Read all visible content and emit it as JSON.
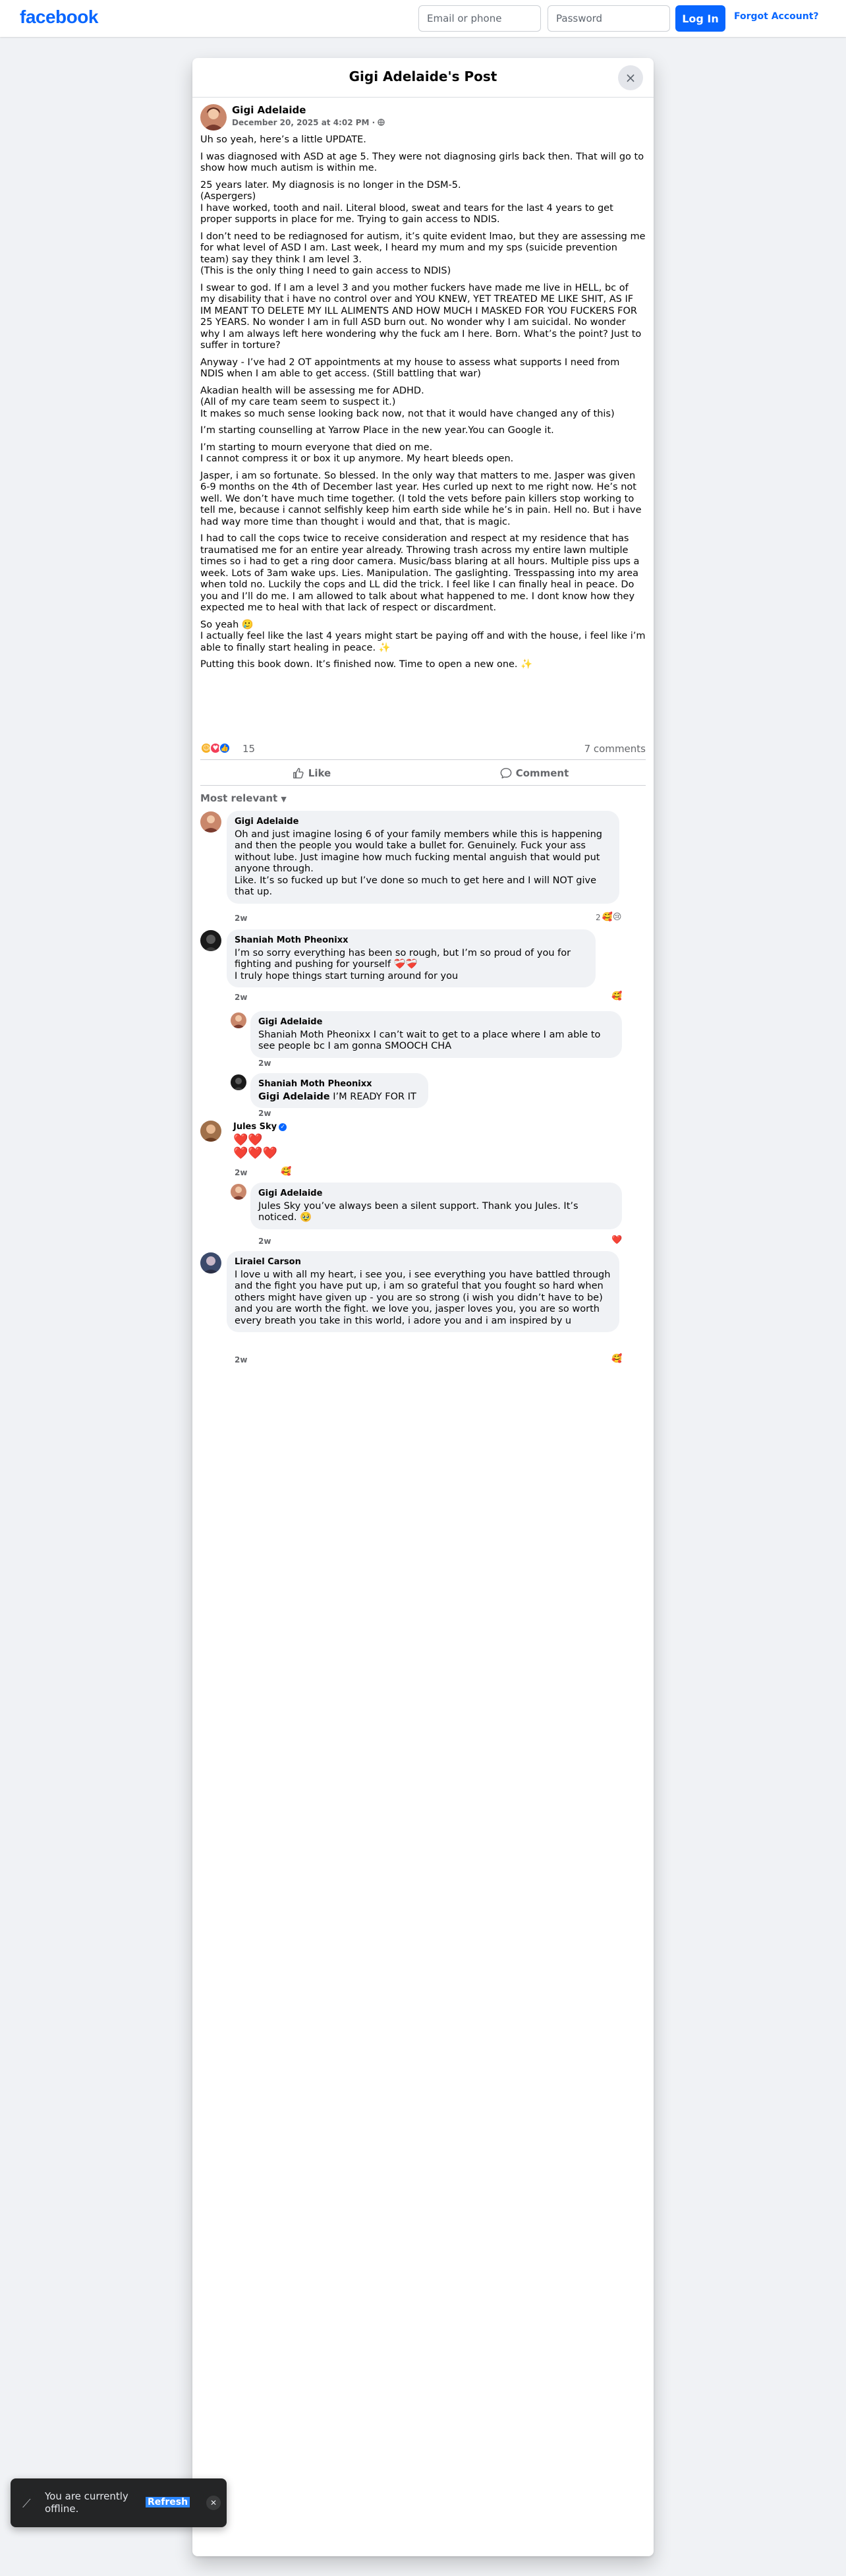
{
  "header": {
    "logo": "facebook",
    "email_placeholder": "Email or phone",
    "password_placeholder": "Password",
    "login_label": "Log In",
    "forgot_label": "Forgot Account?"
  },
  "modal": {
    "title": "Gigi Adelaide's Post",
    "close_icon": "×"
  },
  "post": {
    "author": "Gigi Adelaide",
    "date": "December 20, 2025 at 4:02 PM",
    "privacy_icon": "globe-icon",
    "paragraphs": [
      "Uh so yeah, here’s a little UPDATE.",
      "I was diagnosed with ASD at age 5. They were not diagnosing girls back then. That will go to show how much autism is within me.",
      "25 years later. My diagnosis is no longer in the DSM-5.\n(Aspergers)\nI have worked, tooth and nail. Literal blood, sweat and tears for the last 4 years to get proper supports in place for me. Trying to gain access to NDIS.",
      "I don’t need to be rediagnosed for autism, it’s quite evident lmao, but they are assessing me for what level of ASD I am. Last week, I heard my mum and my sps (suicide prevention team) say they think I am level 3.\n(This is the only thing I need to gain access to NDIS)",
      "I swear to god. If I am a level 3 and you mother fuckers have made me live in HELL, bc of my disability that i have no control over and YOU KNEW, YET TREATED ME LIKE SHIT, AS IF IM MEANT TO DELETE MY ILL ALIMENTS AND HOW MUCH I MASKED FOR YOU FUCKERS FOR 25 YEARS. No wonder I am in full ASD burn out. No wonder why I am suicidal. No wonder why I am always left here wondering why the fuck am I here. Born. What’s the point? Just to suffer in torture?",
      "Anyway - I’ve had 2 OT appointments at my house to assess what supports I need from NDIS when I am able to get access. (Still battling that war)",
      "Akadian health will be assessing me for ADHD.\n(All of my care team seem to suspect it.)\nIt makes so much sense looking back now, not that it would have changed any of this)",
      "I’m starting counselling at Yarrow Place in the new year.You can Google it.",
      "I’m starting to mourn everyone that died on me.\nI cannot compress it or box it up anymore. My heart bleeds open.",
      "Jasper, i am so fortunate. So blessed. In the only way that matters to me. Jasper was given 6-9 months on the 4th of December last year. Hes curled up next to me right now. He’s not well. We don’t have much time together. (I told the vets before pain killers stop working to tell me, because i cannot selfishly keep him earth side while he’s in pain. Hell no. But i have had way more time than thought i would and that, that is magic.",
      "I had to call the cops twice to receive consideration and respect at my residence that has traumatised me for an entire year already. Throwing trash across my entire lawn multiple times so i had to get a ring door camera. Music/bass blaring at all hours. Multiple piss ups a week. Lots of 3am wake ups. Lies. Manipulation. The gaslighting. Tresspassing into my area when told no. Luckily the cops and LL did the trick. I feel like I can finally heal in peace. Do you and I’ll do me. I am allowed to talk about what happened to me. I dont know how they expected me to heal with that lack of respect or discardment.",
      "So yeah 🥲\nI actually feel like the last 4 years might start be paying off and with the house, i feel like i’m able to finally start healing in peace. ✨",
      "Putting this book down. It’s finished now. Time to open a new one. ✨"
    ],
    "reaction_count": "15",
    "comment_count": "7 comments"
  },
  "actions": {
    "like_label": "Like",
    "comment_label": "Comment",
    "sort_label": "Most relevant"
  },
  "comments": [
    {
      "name": "Gigi Adelaide",
      "text": "Oh and just imagine losing 6 of your family members while this is happening and then the people you would take a bullet for. Genuinely. Fuck your ass without lube. Just imagine how much fucking mental anguish that would put anyone through.\nLike. It’s so fucked up but I’ve done so much to get here and I will NOT give that up.",
      "time": "2w",
      "reaction_count": "2",
      "reactions": "🥰😢"
    },
    {
      "name": "Shaniah Moth Pheonixx",
      "text": "I’m so sorry everything has been so rough, but I’m so proud of you for fighting and pushing for yourself ❤️‍🩹❤️‍🩹\nI truly hope things start turning around for you",
      "time": "2w",
      "reactions": "🥰"
    },
    {
      "name": "Gigi Adelaide",
      "text": "Shaniah Moth Pheonixx I can’t wait to get to a place where I am able to see people bc I am gonna SMOOCH CHA",
      "time": "2w"
    },
    {
      "name": "Shaniah Moth Pheonixx",
      "tag": "Gigi Adelaide",
      "text": " I’M READY FOR IT",
      "time": "2w"
    },
    {
      "name": "Jules Sky",
      "text": "❤️❤️\n❤️❤️❤️",
      "time": "2w",
      "reactions": "🥰"
    },
    {
      "name": "Gigi Adelaide",
      "text": "Jules Sky you’ve always been a silent support. Thank you Jules. It’s noticed. 🥹",
      "time": "2w",
      "reactions": "❤️"
    },
    {
      "name": "Liraiel Carson",
      "text": "I love u with all my heart, i see you, i see everything you have battled through and the fight you have put up, i am so grateful that you fought so hard when others might have given up - you are so strong (i wish you didn’t have to be) and you are worth the fight. we love you, jasper loves you, you are so worth every breath you take in this world, i adore you and i am inspired by u",
      "time": "2w",
      "reactions": "🥰"
    }
  ],
  "toast": {
    "text": "You are currently offline.",
    "refresh_label": "Refresh"
  },
  "colors": {
    "brand": "#0866ff",
    "background": "#f0f2f5",
    "bubble": "#f0f2f5",
    "secondary_text": "#65676b"
  }
}
